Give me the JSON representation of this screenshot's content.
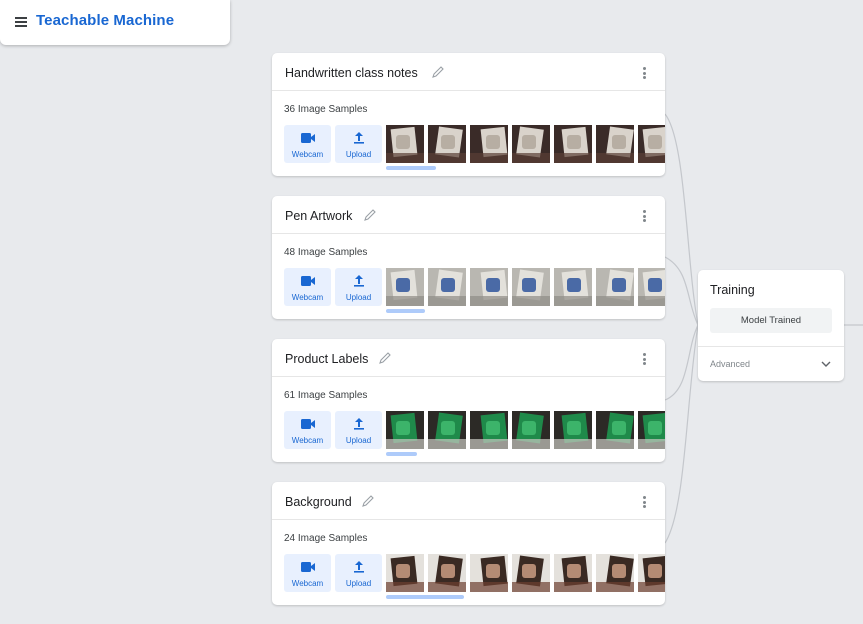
{
  "app": {
    "title": "Teachable Machine"
  },
  "colors": {
    "accent": "#1967d2",
    "accent_light": "#e8f0fe",
    "background": "#e8eaed",
    "scrollbar": "#aecbfa"
  },
  "classes": [
    {
      "name": "Handwritten class notes",
      "sample_count": "36 Image Samples",
      "webcam_label": "Webcam",
      "upload_label": "Upload",
      "thumb_style": "notes",
      "visible_thumbnails": 7,
      "scroll_fraction": 0.18
    },
    {
      "name": "Pen Artwork",
      "sample_count": "48 Image Samples",
      "webcam_label": "Webcam",
      "upload_label": "Upload",
      "thumb_style": "artwork",
      "visible_thumbnails": 7,
      "scroll_fraction": 0.14
    },
    {
      "name": "Product Labels",
      "sample_count": "61 Image Samples",
      "webcam_label": "Webcam",
      "upload_label": "Upload",
      "thumb_style": "labels",
      "visible_thumbnails": 7,
      "scroll_fraction": 0.11
    },
    {
      "name": "Background",
      "sample_count": "24 Image Samples",
      "webcam_label": "Webcam",
      "upload_label": "Upload",
      "thumb_style": "person",
      "visible_thumbnails": 7,
      "scroll_fraction": 0.28
    }
  ],
  "training": {
    "title": "Training",
    "status_button": "Model Trained",
    "advanced_label": "Advanced"
  },
  "icons": {
    "menu": "hamburger-icon",
    "edit": "pencil-icon",
    "more": "kebab-menu-icon",
    "webcam": "videocam-icon",
    "upload": "upload-icon",
    "expand": "chevron-down-icon"
  }
}
